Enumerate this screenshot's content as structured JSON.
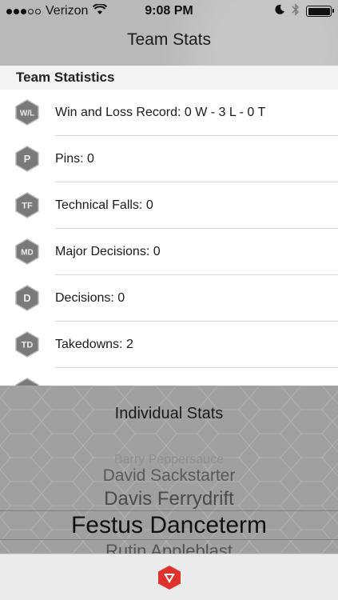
{
  "status_bar": {
    "carrier": "Verizon",
    "time": "9:08 PM"
  },
  "nav": {
    "title": "Team Stats"
  },
  "section": {
    "title": "Team Statistics"
  },
  "stats": [
    {
      "badge": "W/L",
      "label": "Win and Loss Record: 0 W - 3 L - 0 T"
    },
    {
      "badge": "P",
      "label": "Pins: 0"
    },
    {
      "badge": "TF",
      "label": "Technical Falls: 0"
    },
    {
      "badge": "MD",
      "label": "Major Decisions: 0"
    },
    {
      "badge": "D",
      "label": "Decisions: 0"
    },
    {
      "badge": "TD",
      "label": "Takedowns: 2"
    }
  ],
  "picker": {
    "title": "Individual Stats",
    "items": [
      "Barry Peppersauce",
      "David Sackstarter",
      "Davis Ferrydrift",
      "Festus Danceterm",
      "Rutin Appleblast"
    ],
    "selected": "Festus Danceterm"
  },
  "colors": {
    "nav_bg": "#b9b9b9",
    "picker_bg": "#a0a0a0",
    "logo_red": "#e0322d"
  }
}
